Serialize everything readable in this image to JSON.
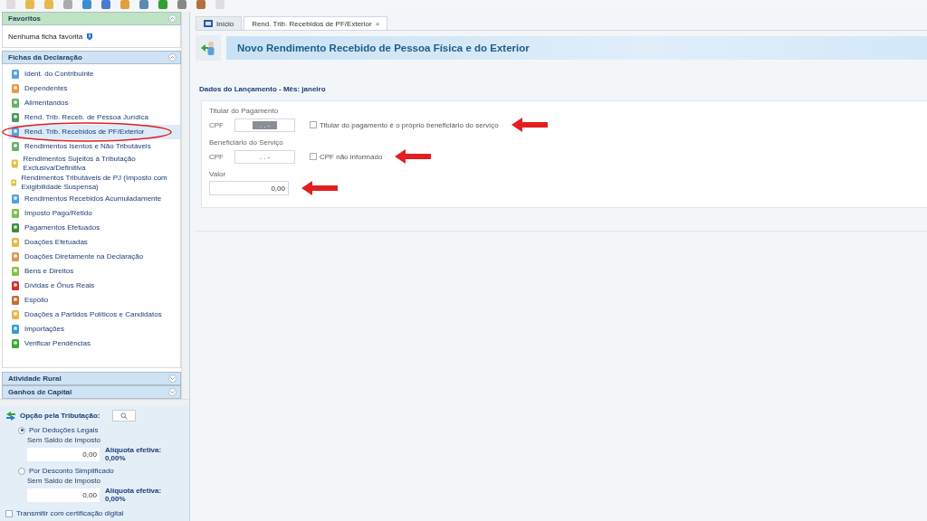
{
  "sidebar": {
    "favorites": {
      "title": "Favoritos",
      "empty_text": "Nenhuma ficha favorita"
    },
    "forms": {
      "title": "Fichas da Declaração",
      "items": [
        {
          "label": "Ident. do Contribuinte",
          "selected": false
        },
        {
          "label": "Dependentes",
          "selected": false
        },
        {
          "label": "Alimentandos",
          "selected": false
        },
        {
          "label": "Rend. Trib. Receb. de Pessoa Jurídica",
          "selected": false
        },
        {
          "label": "Rend. Trib. Recebidos de PF/Exterior",
          "selected": true
        },
        {
          "label": "Rendimentos Isentos e Não Tributáveis",
          "selected": false
        },
        {
          "label": "Rendimentos Sujeitos à Tributação Exclusiva/Definitiva",
          "selected": false
        },
        {
          "label": "Rendimentos Tributáveis de PJ (Imposto com Exigibilidade Suspensa)",
          "selected": false
        },
        {
          "label": "Rendimentos Recebidos Acumuladamente",
          "selected": false
        },
        {
          "label": "Imposto Pago/Retido",
          "selected": false
        },
        {
          "label": "Pagamentos Efetuados",
          "selected": false
        },
        {
          "label": "Doações Efetuadas",
          "selected": false
        },
        {
          "label": "Doações Diretamente na Declaração",
          "selected": false
        },
        {
          "label": "Bens e Direitos",
          "selected": false
        },
        {
          "label": "Dívidas e Ônus Reais",
          "selected": false
        },
        {
          "label": "Espólio",
          "selected": false
        },
        {
          "label": "Doações a Partidos Políticos e Candidatos",
          "selected": false
        },
        {
          "label": "Importações",
          "selected": false
        },
        {
          "label": "Verificar Pendências",
          "selected": false
        }
      ]
    },
    "collapsed_sections": [
      "Atividade Rural",
      "Ganhos de Capital"
    ],
    "taxation": {
      "title": "Opção pela Tributação:",
      "options": [
        {
          "label": "Por Deduções Legais",
          "selected": true,
          "caption": "Sem Saldo de Imposto",
          "value": "0,00",
          "rate": "Alíquota efetiva: 0,00%"
        },
        {
          "label": "Por Desconto Simplificado",
          "selected": false,
          "caption": "Sem Saldo de Imposto",
          "value": "0,00",
          "rate": "Alíquota efetiva: 0,00%"
        }
      ],
      "digital_cert": {
        "label": "Transmitir com certificação digital",
        "checked": false
      }
    }
  },
  "tabs": [
    {
      "label": "Início",
      "selected": false
    },
    {
      "label": "Rend. Trib. Recebidos de PF/Exterior",
      "selected": true,
      "close": "×"
    }
  ],
  "page": {
    "title": "Novo Rendimento Recebido de Pessoa Física e do Exterior",
    "section": "Dados do Lançamento - Mês: janeiro",
    "fields": [
      {
        "group": "Titular do Pagamento",
        "label": "CPF",
        "placeholder": ". . -",
        "highlighted": true,
        "checkbox": {
          "label": "Titular do pagamento é o próprio beneficiário do serviço",
          "checked": false
        }
      },
      {
        "group": "Beneficiário do Serviço",
        "label": "CPF",
        "placeholder": ". . -",
        "highlighted": false,
        "checkbox": {
          "label": "CPF não informado",
          "checked": false
        }
      }
    ],
    "amount": {
      "label": "Valor",
      "value": "0,00"
    }
  }
}
